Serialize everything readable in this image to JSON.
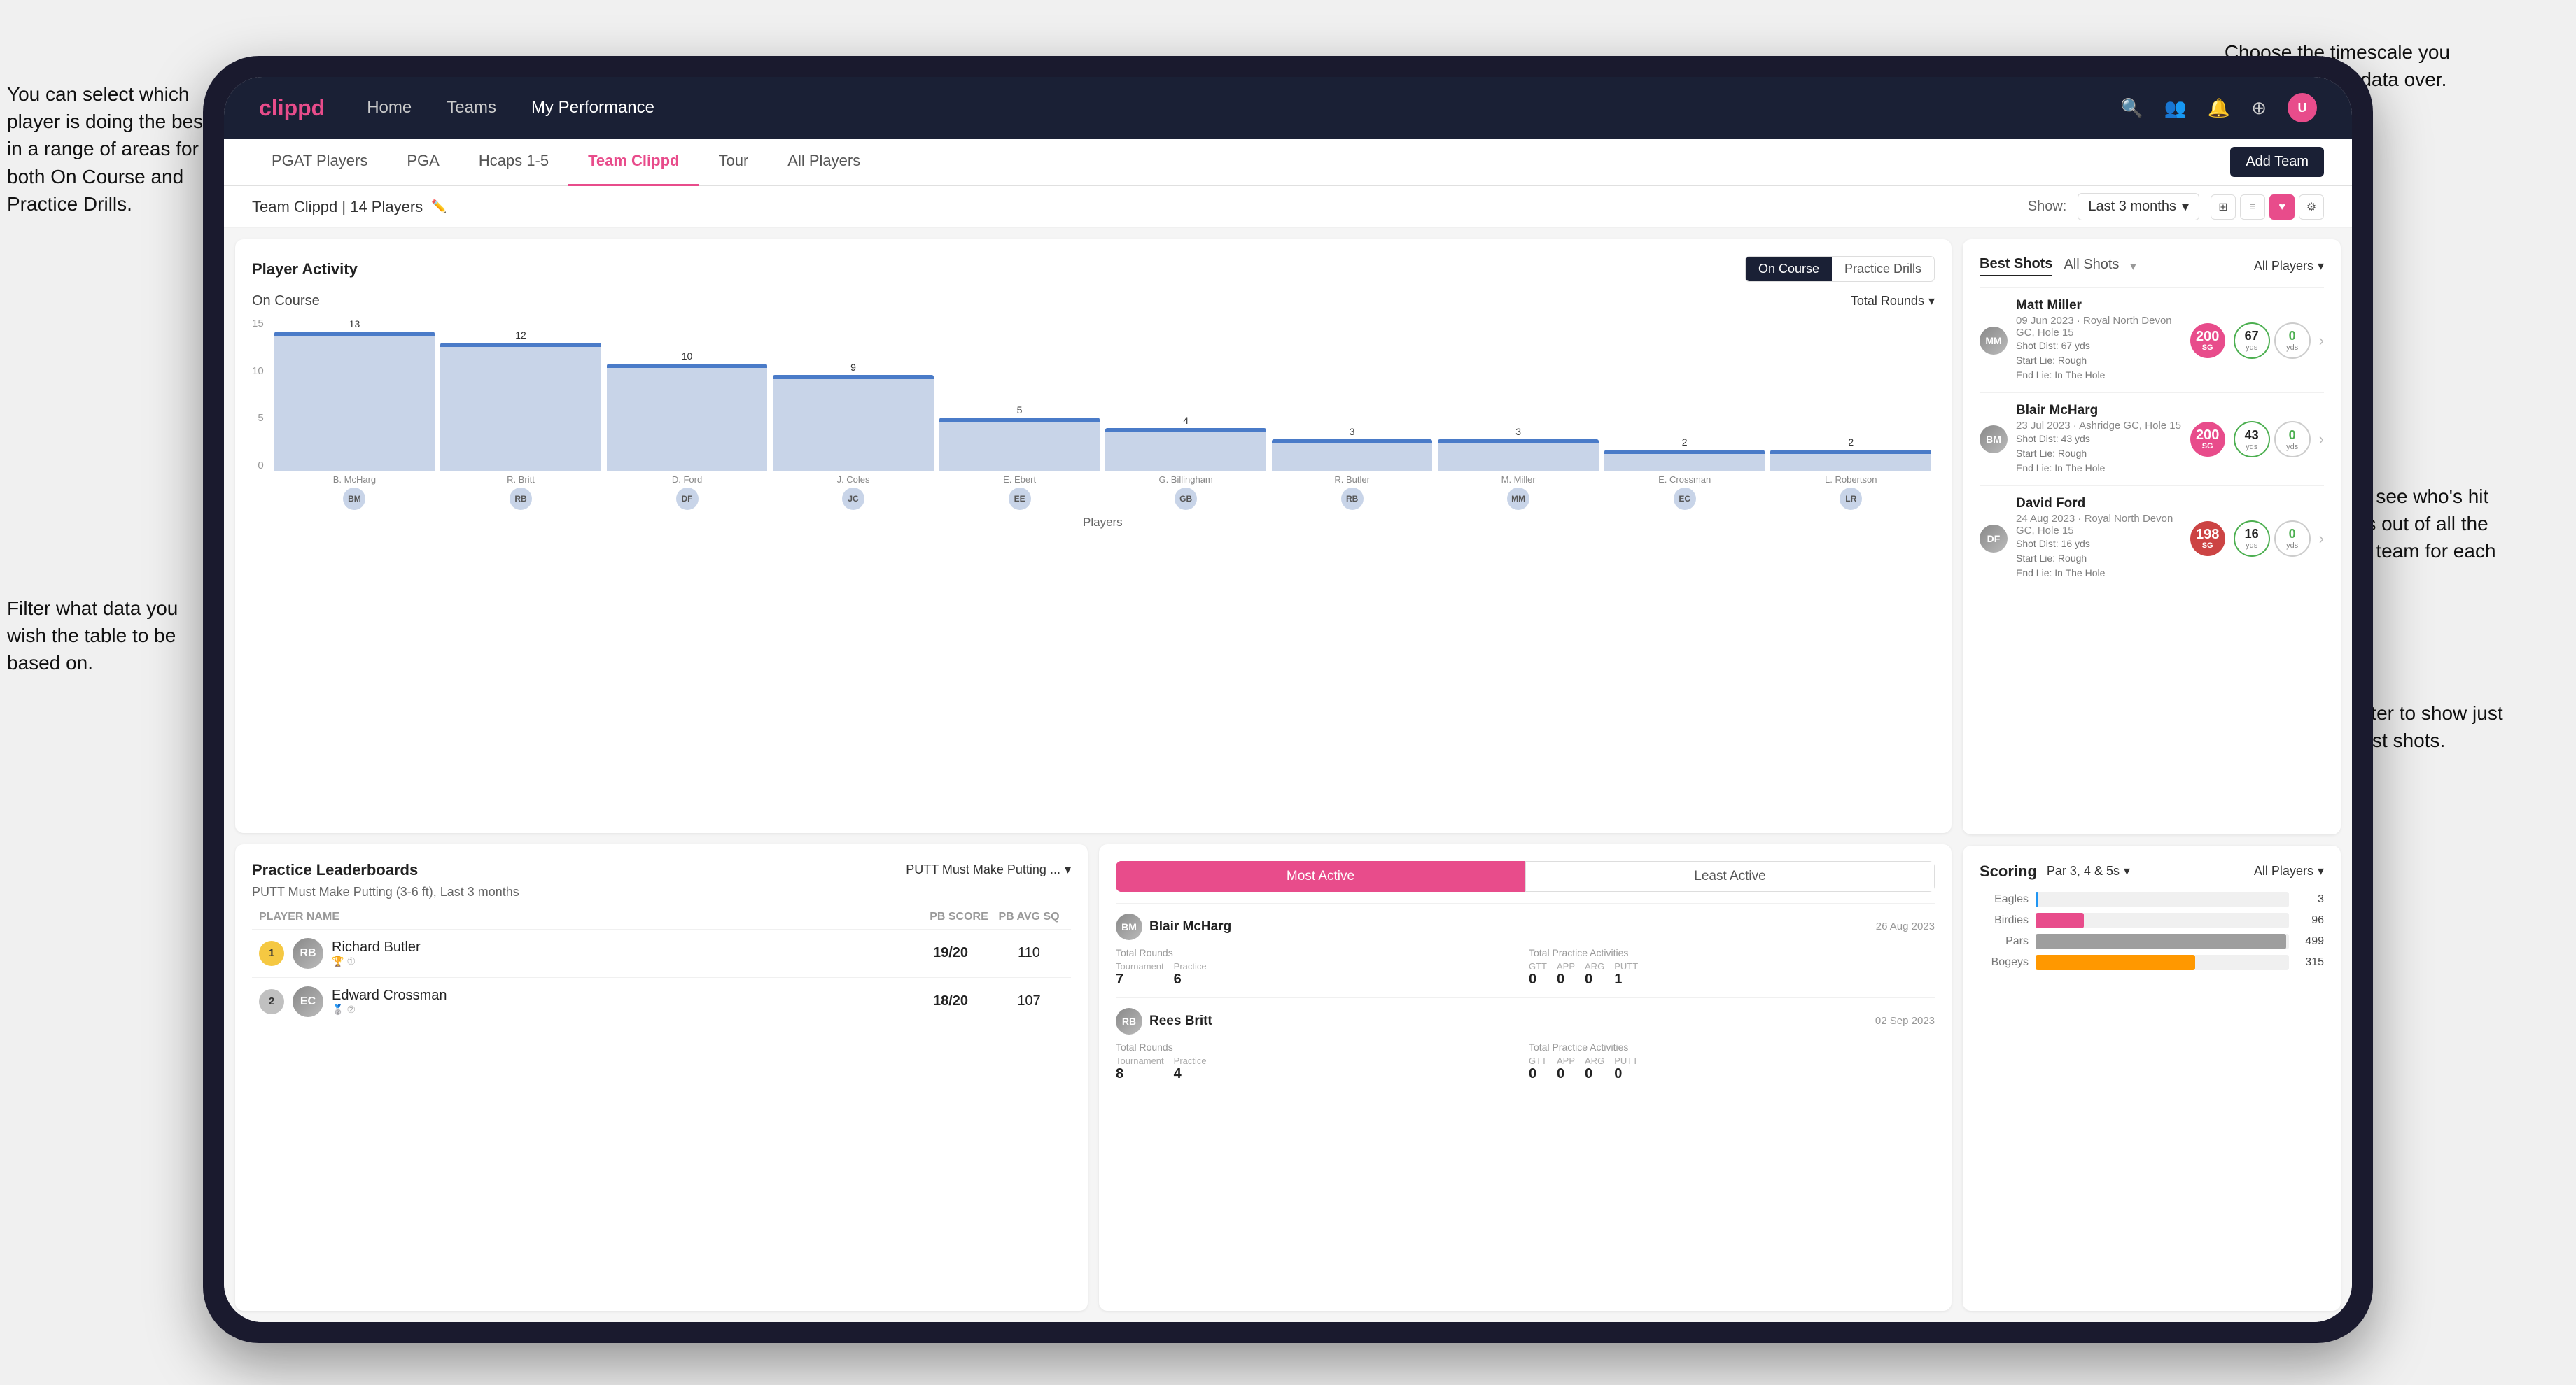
{
  "annotations": {
    "top_right": "Choose the timescale you\nwish to see the data over.",
    "left_top": "You can select which player is\ndoing the best in a range of\nareas for both On Course and\nPractice Drills.",
    "left_bottom": "Filter what data you wish the\ntable to be based on.",
    "right_mid": "Here you can see who's hit\nthe best shots out of all the\nplayers in the team for\neach department.",
    "right_bottom": "You can also filter to show\njust one player's best shots."
  },
  "nav": {
    "logo": "clippd",
    "links": [
      "Home",
      "Teams",
      "My Performance"
    ],
    "icons": [
      "search",
      "users",
      "bell",
      "plus",
      "user"
    ]
  },
  "sub_nav": {
    "items": [
      "PGAT Players",
      "PGA",
      "Hcaps 1-5",
      "Team Clippd",
      "Tour",
      "All Players"
    ],
    "active": "Team Clippd",
    "add_btn": "Add Team"
  },
  "team_header": {
    "name": "Team Clippd | 14 Players",
    "show_label": "Show:",
    "show_value": "Last 3 months",
    "view_icons": [
      "grid",
      "list",
      "heart",
      "settings"
    ]
  },
  "player_activity": {
    "title": "Player Activity",
    "toggle": [
      "On Course",
      "Practice Drills"
    ],
    "active_toggle": "On Course",
    "section_title": "On Course",
    "chart_dropdown": "Total Rounds",
    "y_labels": [
      "15",
      "10",
      "5",
      "0"
    ],
    "bars": [
      {
        "name": "B. McHarg",
        "value": 13,
        "initials": "BM"
      },
      {
        "name": "R. Britt",
        "value": 12,
        "initials": "RB"
      },
      {
        "name": "D. Ford",
        "value": 10,
        "initials": "DF"
      },
      {
        "name": "J. Coles",
        "value": 9,
        "initials": "JC"
      },
      {
        "name": "E. Ebert",
        "value": 5,
        "initials": "EE"
      },
      {
        "name": "G. Billingham",
        "value": 4,
        "initials": "GB"
      },
      {
        "name": "R. Butler",
        "value": 3,
        "initials": "RB"
      },
      {
        "name": "M. Miller",
        "value": 3,
        "initials": "MM"
      },
      {
        "name": "E. Crossman",
        "value": 2,
        "initials": "EC"
      },
      {
        "name": "L. Robertson",
        "value": 2,
        "initials": "LR"
      }
    ],
    "x_axis_title": "Players",
    "y_axis_title": "Total Rounds"
  },
  "practice_leaderboards": {
    "title": "Practice Leaderboards",
    "dropdown": "PUTT Must Make Putting ...",
    "subtitle": "PUTT Must Make Putting (3-6 ft), Last 3 months",
    "columns": [
      "PLAYER NAME",
      "PB SCORE",
      "PB AVG SQ"
    ],
    "rows": [
      {
        "rank": 1,
        "name": "Richard Butler",
        "score": "19/20",
        "avg": "110",
        "initials": "RB"
      },
      {
        "rank": 2,
        "name": "Edward Crossman",
        "score": "18/20",
        "avg": "107",
        "initials": "EC"
      }
    ]
  },
  "best_shots": {
    "tabs": [
      "Best Shots",
      "All Shots"
    ],
    "active_tab": "Best Shots",
    "dropdown": "All Players",
    "players": [
      {
        "name": "Matt Miller",
        "detail": "09 Jun 2023 · Royal North Devon GC, Hole 15",
        "badge_num": "200",
        "badge_label": "SG",
        "shot_dist": "Shot Dist: 67 yds",
        "start_lie": "Start Lie: Rough",
        "end_lie": "End Lie: In The Hole",
        "stat1_val": "67",
        "stat1_unit": "yds",
        "stat2_val": "0",
        "stat2_unit": "yds",
        "initials": "MM"
      },
      {
        "name": "Blair McHarg",
        "detail": "23 Jul 2023 · Ashridge GC, Hole 15",
        "badge_num": "200",
        "badge_label": "SG",
        "shot_dist": "Shot Dist: 43 yds",
        "start_lie": "Start Lie: Rough",
        "end_lie": "End Lie: In The Hole",
        "stat1_val": "43",
        "stat1_unit": "yds",
        "stat2_val": "0",
        "stat2_unit": "yds",
        "initials": "BM"
      },
      {
        "name": "David Ford",
        "detail": "24 Aug 2023 · Royal North Devon GC, Hole 15",
        "badge_num": "198",
        "badge_label": "SG",
        "shot_dist": "Shot Dist: 16 yds",
        "start_lie": "Start Lie: Rough",
        "end_lie": "End Lie: In The Hole",
        "stat1_val": "16",
        "stat1_unit": "yds",
        "stat2_val": "0",
        "stat2_unit": "yds",
        "initials": "DF"
      }
    ]
  },
  "most_active": {
    "tabs": [
      "Most Active",
      "Least Active"
    ],
    "active_tab": "Most Active",
    "players": [
      {
        "name": "Blair McHarg",
        "date": "26 Aug 2023",
        "total_rounds_title": "Total Rounds",
        "tournament": "7",
        "practice": "6",
        "total_practice_title": "Total Practice Activities",
        "gtt": "0",
        "app": "0",
        "arg": "0",
        "putt": "1",
        "initials": "BM"
      },
      {
        "name": "Rees Britt",
        "date": "02 Sep 2023",
        "total_rounds_title": "Total Rounds",
        "tournament": "8",
        "practice": "4",
        "total_practice_title": "Total Practice Activities",
        "gtt": "0",
        "app": "0",
        "arg": "0",
        "putt": "0",
        "initials": "RB"
      }
    ]
  },
  "scoring": {
    "title": "Scoring",
    "par_dropdown": "Par 3, 4 & 5s",
    "players_dropdown": "All Players",
    "rows": [
      {
        "label": "Eagles",
        "value": 3,
        "max": 500,
        "color": "bar-eagle"
      },
      {
        "label": "Birdies",
        "value": 96,
        "max": 500,
        "color": "bar-birdie"
      },
      {
        "label": "Pars",
        "value": 499,
        "max": 500,
        "color": "bar-par"
      },
      {
        "label": "Bogeys",
        "value": 315,
        "max": 500,
        "color": "bar-bogey"
      }
    ]
  },
  "colors": {
    "brand_pink": "#e84c8b",
    "nav_dark": "#1a2035",
    "accent_blue": "#4a7bc8"
  }
}
